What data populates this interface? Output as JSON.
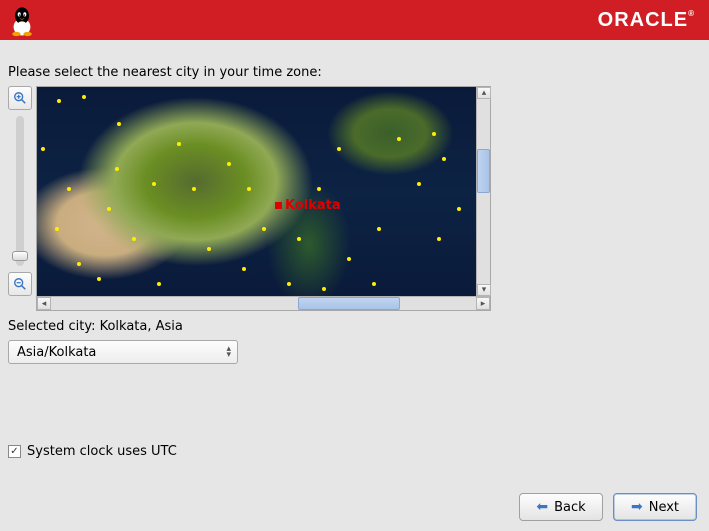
{
  "header": {
    "brand": "ORACLE"
  },
  "prompt": "Please select the nearest city in your time zone:",
  "map": {
    "selected_city_label": "Kolkata",
    "selected_city_text": "Selected city: Kolkata, Asia"
  },
  "timezone_combo": {
    "value": "Asia/Kolkata"
  },
  "utc": {
    "checked": true,
    "label": "System clock uses UTC"
  },
  "buttons": {
    "back": "Back",
    "next": "Next"
  }
}
